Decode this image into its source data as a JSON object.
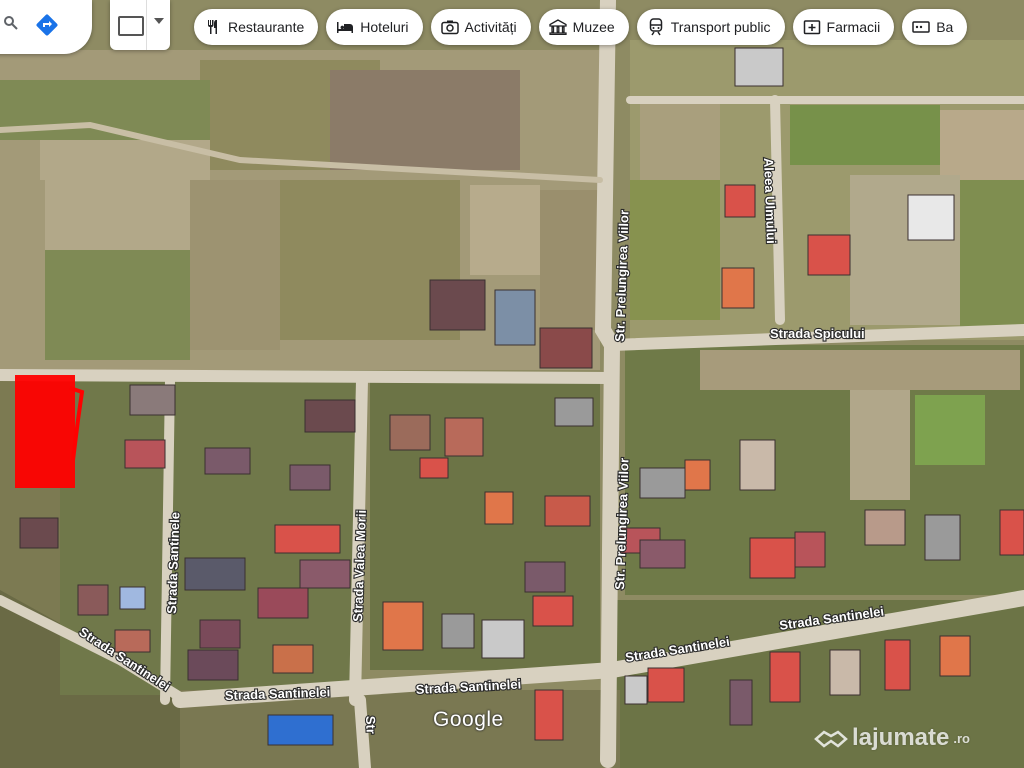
{
  "toolbar": {
    "search_icon": "search-icon",
    "directions_icon": "directions-icon",
    "layers_icon": "keyboard-icon",
    "layers_dropdown_icon": "chevron-down-icon"
  },
  "chips": [
    {
      "label": "Restaurante",
      "icon": "fork-knife-icon"
    },
    {
      "label": "Hoteluri",
      "icon": "bed-icon"
    },
    {
      "label": "Activități",
      "icon": "camera-icon"
    },
    {
      "label": "Muzee",
      "icon": "museum-icon"
    },
    {
      "label": "Transport public",
      "icon": "train-icon"
    },
    {
      "label": "Farmacii",
      "icon": "pharmacy-icon"
    },
    {
      "label": "Ba",
      "icon": "atm-icon"
    }
  ],
  "streets": {
    "prelungirea_vilor_north": "Str. Prelungirea Viilor",
    "prelungirea_vilor_south": "Str. Prelungirea Viilor",
    "aleea_ulmului": "Aleea Ulmului",
    "strada_spicului": "Strada Spicului",
    "strada_santinelei_east": "Strada Santinelei",
    "strada_santinelei_mid": "Strada Santinelei",
    "strada_santinelei_bottom": "Strada Santinelei",
    "strada_santinelei_far_east": "Strada Santinelei",
    "strada_santinelei_diag": "Strada Santinelei",
    "strada_santinele": "Strada Santinele",
    "strada_valea_morii": "Strada Valea Morii",
    "str_bottom": "Str"
  },
  "attribution": {
    "google": "Google",
    "watermark": "lajumate",
    "watermark_tld": ".ro"
  },
  "colors": {
    "highlight": "#ff0000",
    "roof_red": "#d9524a",
    "roof_orange": "#e0764a"
  }
}
